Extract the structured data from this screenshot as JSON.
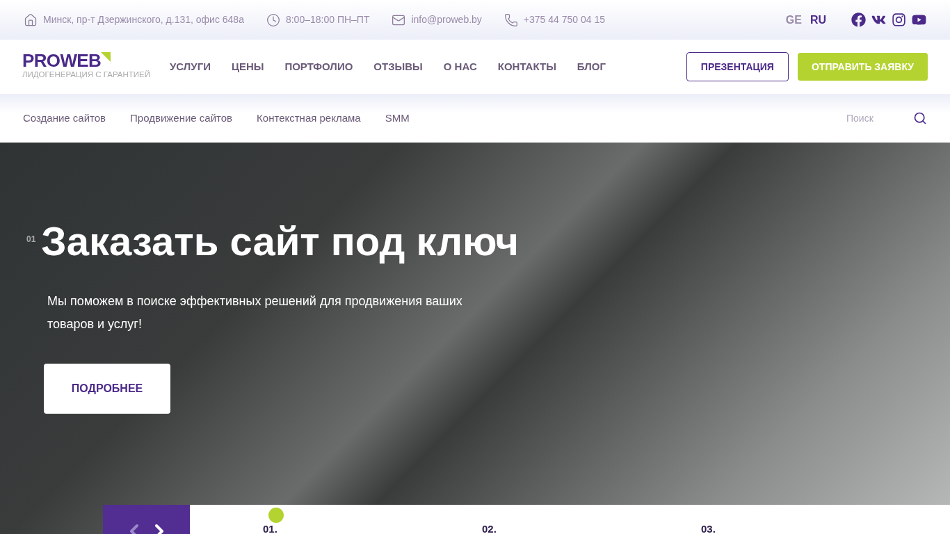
{
  "topbar": {
    "address": "Минск, пр-т Дзержинского, д.131, офис 648а",
    "hours": "8:00–18:00 ПН–ПТ",
    "email": "info@proweb.by",
    "phone": "+375 44 750 04 15",
    "languages": [
      {
        "label": "GE",
        "selected": false
      },
      {
        "label": "RU",
        "selected": true
      }
    ],
    "socials": [
      {
        "kind": "facebook"
      },
      {
        "kind": "vk"
      },
      {
        "kind": "instagram"
      },
      {
        "kind": "youtube"
      }
    ]
  },
  "header": {
    "logo": "PROWEB",
    "tagline": "ЛИДОГЕНЕРАЦИЯ С ГАРАНТИЕЙ",
    "nav": [
      "УСЛУГИ",
      "ЦЕНЫ",
      "ПОРТФОЛИО",
      "ОТЗЫВЫ",
      "О НАС",
      "КОНТАКТЫ",
      "БЛОГ"
    ],
    "presentation_button": "ПРЕЗЕНТАЦИЯ",
    "request_button": "ОТПРАВИТЬ ЗАЯВКУ"
  },
  "subnav": {
    "items": [
      "Создание сайтов",
      "Продвижение сайтов",
      "Контекстная реклама",
      "SMM"
    ],
    "search": {
      "placeholder": "Поиск"
    }
  },
  "hero": {
    "slide_number": "01",
    "title": "Заказать сайт под ключ",
    "text": "Мы поможем в поиске эффективных решений для продвижения ваших товаров и услуг!",
    "button": "ПОДРОБНЕЕ"
  },
  "slider_tabs": [
    {
      "label": "01.",
      "selected": true
    },
    {
      "label": "02.",
      "selected": false
    },
    {
      "label": "03.",
      "selected": false
    }
  ]
}
